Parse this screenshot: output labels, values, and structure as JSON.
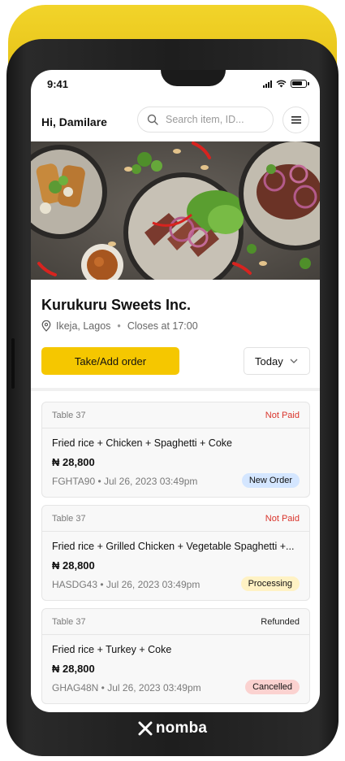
{
  "status_bar": {
    "time": "9:41"
  },
  "header": {
    "greeting": "Hi, Damilare",
    "search_placeholder": "Search item, ID...",
    "menu_icon": "menu-icon"
  },
  "store": {
    "name": "Kurukuru Sweets Inc.",
    "location": "Ikeja, Lagos",
    "separator": "•",
    "hours": "Closes at 17:00"
  },
  "actions": {
    "take_order_label": "Take/Add order",
    "date_filter": "Today"
  },
  "orders": [
    {
      "table": "Table 37",
      "payment_status": "Not Paid",
      "items": "Fried rice + Chicken + Spaghetti + Coke",
      "price": "₦ 28,800",
      "meta": "FGHTA90 • Jul 26, 2023 03:49pm",
      "status": "New Order"
    },
    {
      "table": "Table 37",
      "payment_status": "Not Paid",
      "items": "Fried rice + Grilled Chicken + Vegetable Spaghetti +...",
      "price": "₦ 28,800",
      "meta": "HASDG43 • Jul 26, 2023 03:49pm",
      "status": "Processing"
    },
    {
      "table": "Table 37",
      "payment_status": "Refunded",
      "items": "Fried rice + Turkey + Coke",
      "price": "₦ 28,800",
      "meta": "GHAG48N • Jul 26, 2023 03:49pm",
      "status": "Cancelled"
    }
  ],
  "brand": {
    "name": "nomba"
  },
  "colors": {
    "accent": "#f5c700",
    "device_yellow": "#f2d42a",
    "not_paid": "#d9342b",
    "badge_new": "#d4e6ff",
    "badge_processing": "#fff2c4",
    "badge_cancelled": "#fbd2d0"
  }
}
